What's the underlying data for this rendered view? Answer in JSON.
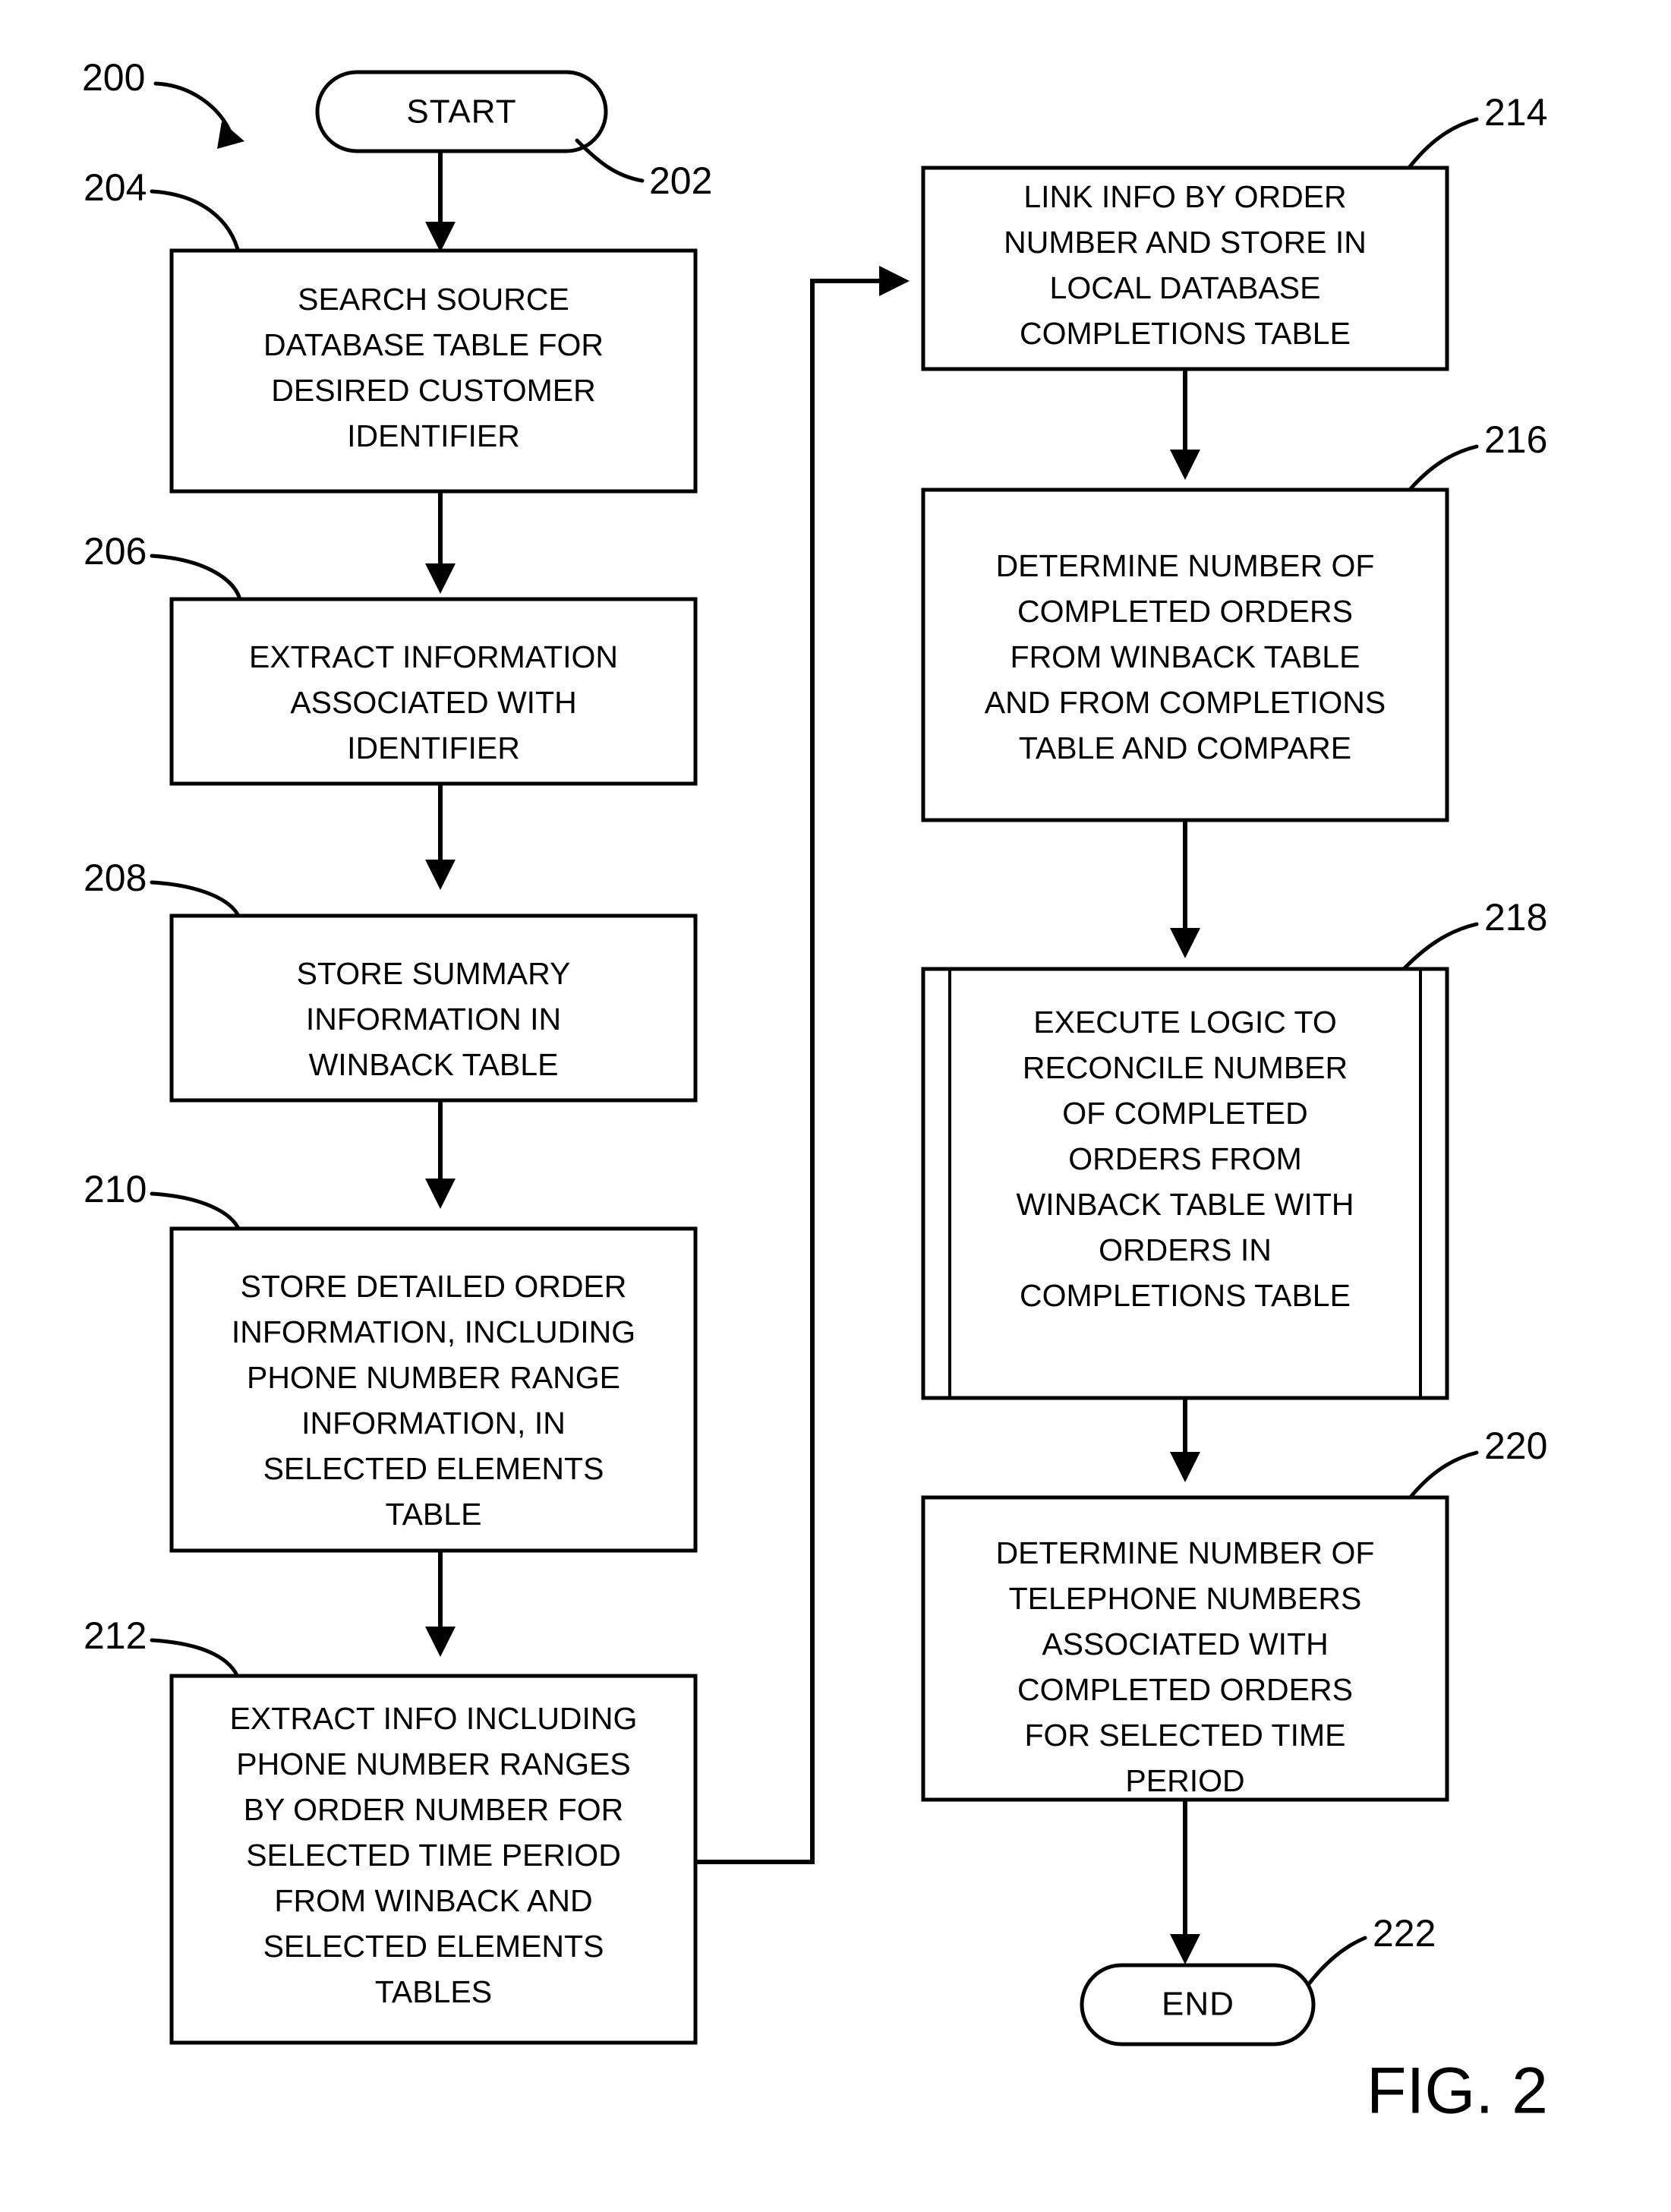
{
  "figure": {
    "caption": "FIG. 2",
    "overall_ref": "200"
  },
  "nodes": {
    "start": {
      "ref": "202",
      "label": "START",
      "shape": "terminator"
    },
    "n204": {
      "ref": "204",
      "shape": "process",
      "lines": [
        "SEARCH SOURCE",
        "DATABASE TABLE FOR",
        "DESIRED CUSTOMER",
        "IDENTIFIER"
      ]
    },
    "n206": {
      "ref": "206",
      "shape": "process",
      "lines": [
        "EXTRACT INFORMATION",
        "ASSOCIATED WITH",
        "IDENTIFIER"
      ]
    },
    "n208": {
      "ref": "208",
      "shape": "process",
      "lines": [
        "STORE SUMMARY",
        "INFORMATION IN",
        "WINBACK TABLE"
      ]
    },
    "n210": {
      "ref": "210",
      "shape": "process",
      "lines": [
        "STORE DETAILED ORDER",
        "INFORMATION, INCLUDING",
        "PHONE NUMBER RANGE",
        "INFORMATION, IN",
        "SELECTED ELEMENTS",
        "TABLE"
      ]
    },
    "n212": {
      "ref": "212",
      "shape": "process",
      "lines": [
        "EXTRACT INFO INCLUDING",
        "PHONE NUMBER RANGES",
        "BY ORDER NUMBER FOR",
        "SELECTED TIME PERIOD",
        "FROM WINBACK AND",
        "SELECTED ELEMENTS",
        "TABLES"
      ]
    },
    "n214": {
      "ref": "214",
      "shape": "process",
      "lines": [
        "LINK INFO BY ORDER",
        "NUMBER AND STORE IN",
        "LOCAL DATABASE",
        "COMPLETIONS TABLE"
      ]
    },
    "n216": {
      "ref": "216",
      "shape": "process",
      "lines": [
        "DETERMINE NUMBER OF",
        "COMPLETED ORDERS",
        "FROM WINBACK TABLE",
        "AND FROM COMPLETIONS",
        "TABLE AND COMPARE"
      ]
    },
    "n218": {
      "ref": "218",
      "shape": "predefined-process",
      "lines": [
        "EXECUTE LOGIC TO",
        "RECONCILE NUMBER",
        "OF COMPLETED",
        "ORDERS FROM",
        "WINBACK TABLE WITH",
        "ORDERS IN",
        "COMPLETIONS TABLE"
      ]
    },
    "n220": {
      "ref": "220",
      "shape": "process",
      "lines": [
        "DETERMINE NUMBER OF",
        "TELEPHONE NUMBERS",
        "ASSOCIATED WITH",
        "COMPLETED ORDERS",
        "FOR SELECTED TIME",
        "PERIOD"
      ]
    },
    "end": {
      "ref": "222",
      "label": "END",
      "shape": "terminator"
    }
  },
  "colors": {
    "stroke": "#000000",
    "fill": "#ffffff"
  }
}
